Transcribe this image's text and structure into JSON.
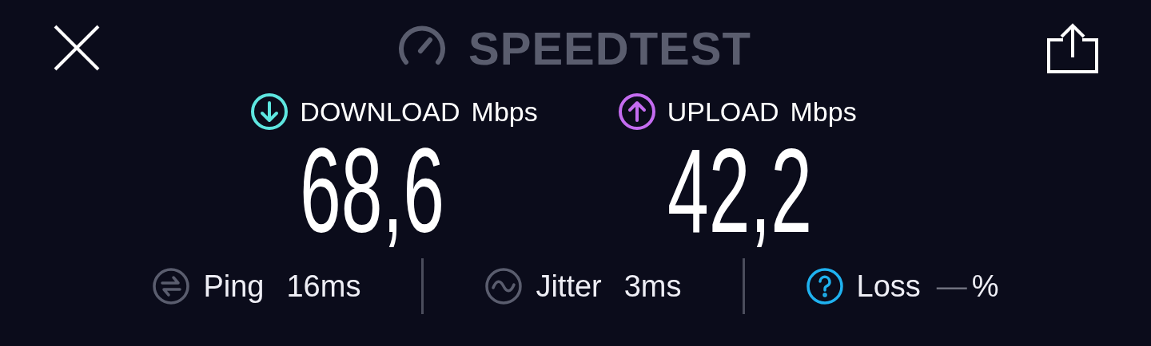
{
  "header": {
    "title": "SPEEDTEST"
  },
  "results": [
    {
      "kind": "download",
      "label": "DOWNLOAD",
      "unit": "Mbps",
      "value": "68,6",
      "color": "#5ee6e0"
    },
    {
      "kind": "upload",
      "label": "UPLOAD",
      "unit": "Mbps",
      "value": "42,2",
      "color": "#c46cf0"
    }
  ],
  "metrics": [
    {
      "kind": "ping",
      "label": "Ping",
      "value": "16ms"
    },
    {
      "kind": "jitter",
      "label": "Jitter",
      "value": "3ms"
    },
    {
      "kind": "loss",
      "label": "Loss",
      "value": "—",
      "unit": "%"
    }
  ]
}
